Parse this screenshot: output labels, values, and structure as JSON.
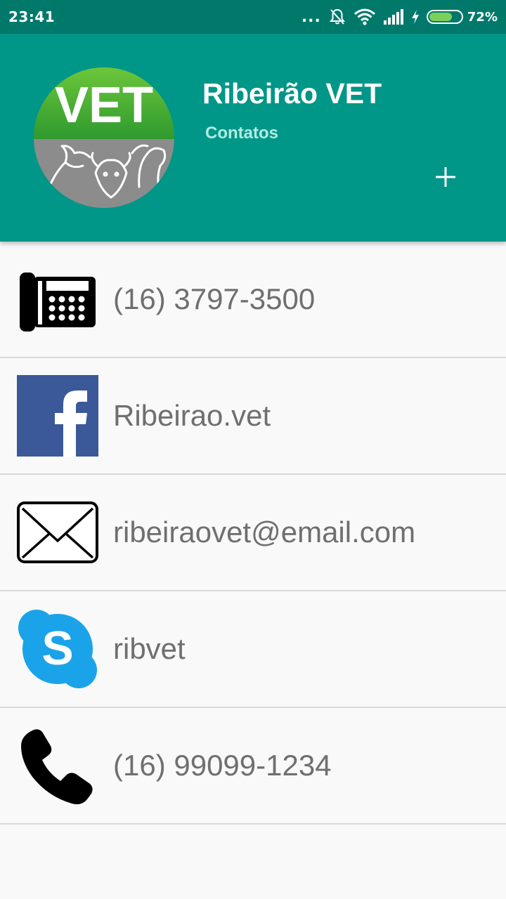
{
  "status_bar": {
    "time": "23:41",
    "dots": "...",
    "battery_percent": "72%",
    "battery_level": 0.72
  },
  "header": {
    "title": "Ribeirão VET",
    "subtitle": "Contatos",
    "logo_text": "VET",
    "add_icon": "plus-icon",
    "color": "#009688"
  },
  "contacts": [
    {
      "icon": "desk-phone-icon",
      "label": "(16) 3797-3500"
    },
    {
      "icon": "facebook-icon",
      "label": "Ribeirao.vet"
    },
    {
      "icon": "email-icon",
      "label": "ribeiraovet@email.com"
    },
    {
      "icon": "skype-icon",
      "label": "ribvet"
    },
    {
      "icon": "phone-handset-icon",
      "label": "(16) 99099-1234"
    }
  ]
}
